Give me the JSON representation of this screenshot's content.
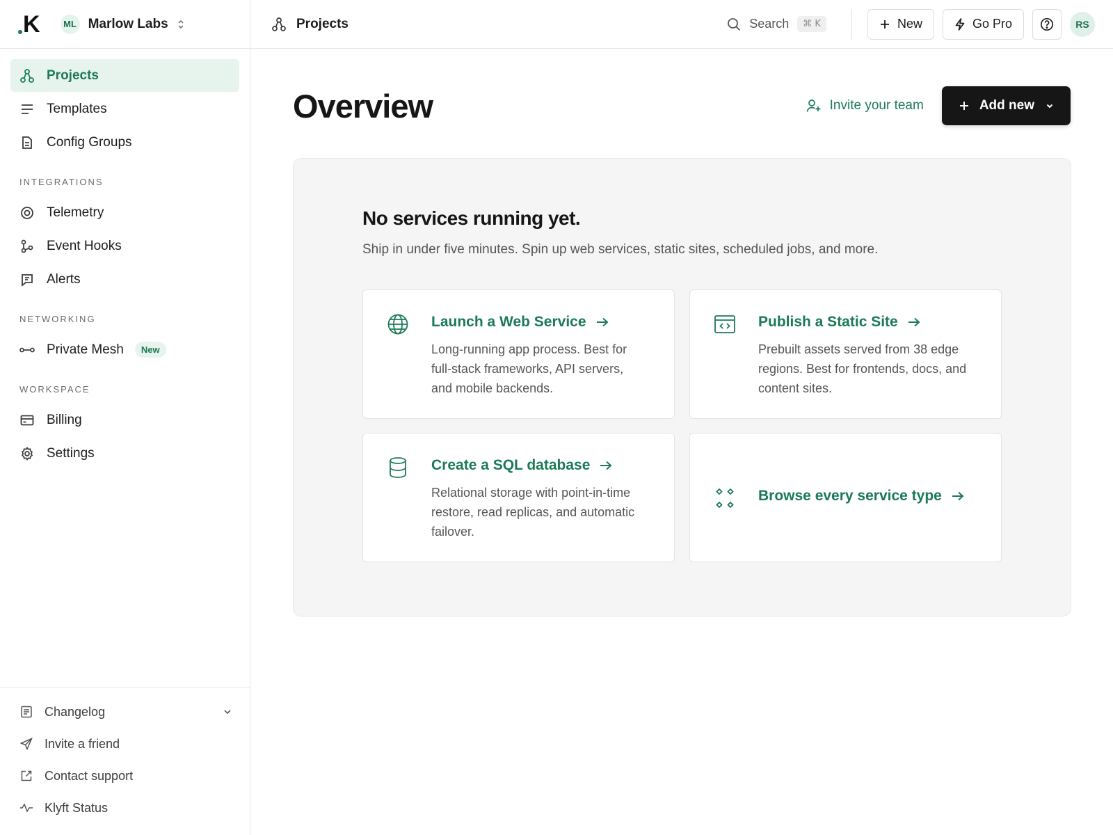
{
  "brand": {
    "logo": "K",
    "org_initials": "ML",
    "org_name": "Marlow Labs"
  },
  "sidebar": {
    "main_items": [
      {
        "label": "Projects",
        "icon": "projects-icon",
        "active": true
      },
      {
        "label": "Templates",
        "icon": "templates-icon"
      },
      {
        "label": "Config Groups",
        "icon": "config-groups-icon"
      }
    ],
    "sections": [
      {
        "label": "INTEGRATIONS",
        "items": [
          {
            "label": "Telemetry",
            "icon": "telemetry-icon"
          },
          {
            "label": "Event Hooks",
            "icon": "event-hooks-icon"
          },
          {
            "label": "Alerts",
            "icon": "alerts-icon"
          }
        ]
      },
      {
        "label": "NETWORKING",
        "items": [
          {
            "label": "Private Mesh",
            "icon": "private-mesh-icon",
            "badge": "New"
          }
        ]
      },
      {
        "label": "WORKSPACE",
        "items": [
          {
            "label": "Billing",
            "icon": "billing-icon"
          },
          {
            "label": "Settings",
            "icon": "gear-icon"
          }
        ]
      }
    ],
    "bottom_items": [
      {
        "label": "Changelog",
        "icon": "changelog-icon"
      },
      {
        "label": "Invite a friend",
        "icon": "send-icon"
      },
      {
        "label": "Contact support",
        "icon": "external-link-icon"
      },
      {
        "label": "Klyft Status",
        "icon": "activity-icon"
      }
    ]
  },
  "topbar": {
    "breadcrumb": "Projects",
    "search_label": "Search",
    "search_shortcut": "⌘ K",
    "new_label": "New",
    "go_pro_label": "Go Pro",
    "user_initials": "RS"
  },
  "main": {
    "title": "Overview",
    "invite_label": "Invite your team",
    "add_new_label": "Add new",
    "empty_title": "No services running yet.",
    "empty_subtitle": "Ship in under five minutes. Spin up web services, static sites, scheduled jobs, and more.",
    "cards": [
      {
        "title": "Launch a Web Service",
        "icon": "globe-icon",
        "description": "Long-running app process. Best for full-stack frameworks, API servers, and mobile backends."
      },
      {
        "title": "Publish a Static Site",
        "icon": "code-window-icon",
        "description": "Prebuilt assets served from 38 edge regions. Best for frontends, docs, and content sites."
      },
      {
        "title": "Create a SQL database",
        "icon": "database-icon",
        "description": "Relational storage with point-in-time restore, read replicas, and automatic failover."
      },
      {
        "title": "Browse every service type",
        "icon": "grid-dots-icon",
        "description": ""
      }
    ]
  },
  "colors": {
    "accent": "#1b7a55",
    "accent_bg": "#e7f4ee",
    "dark_button": "#161616",
    "panel_bg": "#f5f5f5"
  }
}
